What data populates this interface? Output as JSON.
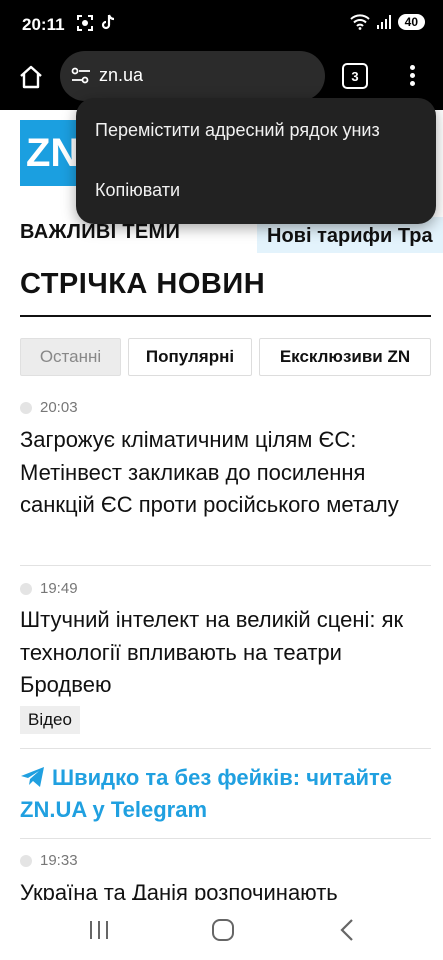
{
  "status": {
    "time": "20:11",
    "battery": "40"
  },
  "browser": {
    "url": "zn.ua",
    "tab_count": "3"
  },
  "menu": {
    "items": [
      "Перемістити адресний рядок униз",
      "Копіювати"
    ]
  },
  "site": {
    "logo": "ZN",
    "topics_label": "ВАЖЛИВІ ТЕМИ",
    "topic_chip": "Нові тарифи Тра",
    "feed_title": "СТРІЧКА НОВИН",
    "tabs": [
      "Останні",
      "Популярні",
      "Ексклюзиви ZN"
    ]
  },
  "news": [
    {
      "time": "20:03",
      "title": "Загрожує кліматичним цілям ЄС: Метінвест закликав до посилення санкцій ЄС проти російського металу"
    },
    {
      "time": "19:49",
      "title": "Штучний інтелект на великій сцені: як технології впливають на театри Бродвею",
      "badge": "Відео"
    },
    {
      "time": "19:33",
      "title": "Україна та Данія розпочинають"
    }
  ],
  "promo": {
    "text": "Швидко та без фейків: читайте ZN.UA у Telegram"
  },
  "colors": {
    "accent": "#1b9fe0",
    "chip_bg": "#e3f3fc",
    "toolbar": "#000000",
    "popup": "#222222"
  }
}
